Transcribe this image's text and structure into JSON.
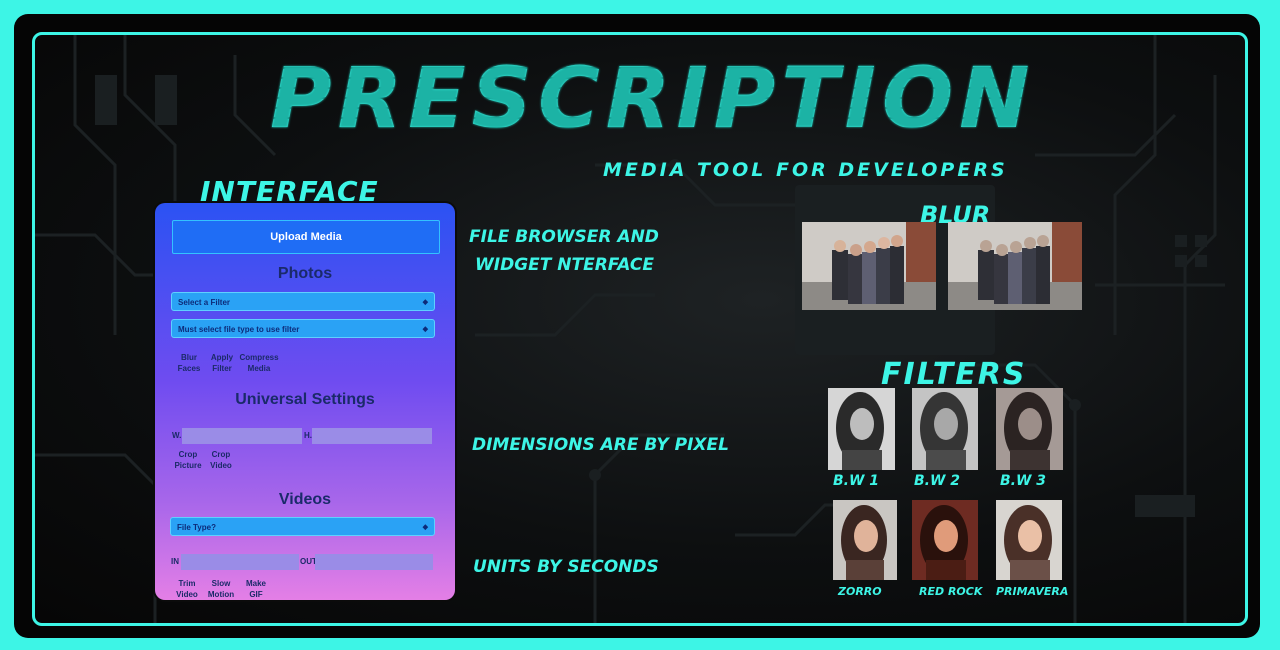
{
  "header": {
    "title": "Prescription",
    "subtitle": "Media Tool for Developers"
  },
  "sections": {
    "interface": "Interface",
    "blur": "Blur",
    "filters": "Filters"
  },
  "notes": {
    "file_browser_line1": "File Browser and",
    "file_browser_line2": "Widget nterface",
    "dimensions": "Dimensions are by pixel",
    "units": "Units by seconds"
  },
  "panel": {
    "upload_label": "Upload Media",
    "photos": {
      "heading": "Photos",
      "filter_select": "Select a Filter",
      "type_select": "Must select file type to use filter",
      "options": [
        {
          "line1": "Blur",
          "line2": "Faces"
        },
        {
          "line1": "Apply",
          "line2": "Filter"
        },
        {
          "line1": "Compress",
          "line2": "Media"
        }
      ]
    },
    "universal": {
      "heading": "Universal Settings",
      "w_label": "W.",
      "h_label": "H.",
      "options": [
        {
          "line1": "Crop",
          "line2": "Picture"
        },
        {
          "line1": "Crop",
          "line2": "Video"
        }
      ]
    },
    "videos": {
      "heading": "Videos",
      "filetype_select": "File Type?",
      "in_label": "IN",
      "out_label": "OUT",
      "options": [
        {
          "line1": "Trim",
          "line2": "Video"
        },
        {
          "line1": "Slow",
          "line2": "Motion"
        },
        {
          "line1": "Make",
          "line2": "GIF"
        }
      ]
    }
  },
  "filters": [
    "B.W 1",
    "B.W 2",
    "B.W 3",
    "Zorro",
    "Red Rock",
    "Primavera"
  ],
  "colors": {
    "accent": "#3df5e6",
    "background": "#050505",
    "panel_top": "#2b52f3",
    "panel_bottom": "#e47fe6"
  }
}
